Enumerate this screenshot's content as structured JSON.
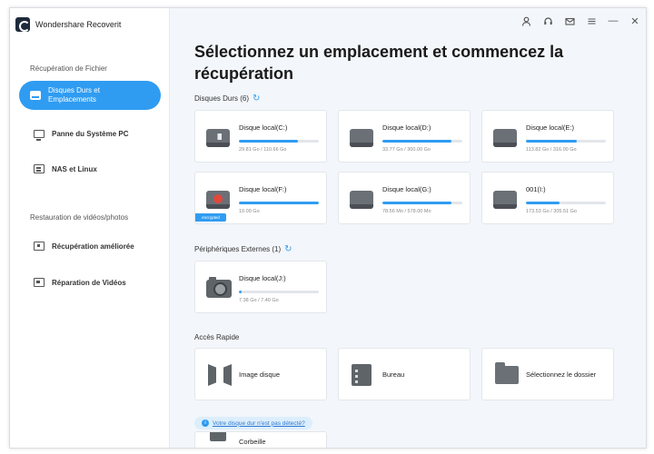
{
  "app": {
    "name": "Wondershare Recoverit"
  },
  "controls": {
    "icons": [
      "user-icon",
      "headset-icon",
      "mail-icon",
      "menu-icon",
      "minimize-icon",
      "close-icon"
    ],
    "minimize": "—",
    "close": "✕"
  },
  "sidebar": {
    "section1": "Récupération de Fichier",
    "section2": "Restauration de vidéos/photos",
    "items": [
      {
        "label1": "Disques Durs et",
        "label2": "Emplacements",
        "icon": "hard-drive-icon",
        "active": true
      },
      {
        "label": "Panne du Système PC",
        "icon": "pc-icon"
      },
      {
        "label": "NAS et Linux",
        "icon": "nas-icon"
      },
      {
        "label": "Récupération améliorée",
        "icon": "video-recovery-icon"
      },
      {
        "label": "Réparation de Vidéos",
        "icon": "video-repair-icon"
      }
    ]
  },
  "main": {
    "title": "Sélectionnez un emplacement et commencez la récupération",
    "disks_label": "Disques Durs (6)",
    "disks": [
      {
        "name": "Disque local(C:)",
        "size": "29.81 Go / 110.66 Go",
        "fill": 0.74,
        "icon": "windows-drive-icon"
      },
      {
        "name": "Disque local(D:)",
        "size": "33.77 Go / 300.00 Go",
        "fill": 0.86,
        "icon": "hard-drive-icon"
      },
      {
        "name": "Disque local(E:)",
        "size": "113.82 Go / 316.00 Go",
        "fill": 0.64,
        "icon": "hard-drive-icon"
      },
      {
        "name": "Disque local(F:)",
        "size": "10.00 Go",
        "fill": 1.0,
        "icon": "hard-drive-red-icon",
        "badge": "encrypted"
      },
      {
        "name": "Disque local(G:)",
        "size": "78.56 Mo / 578.00 Mo",
        "fill": 0.86,
        "icon": "hard-drive-icon"
      },
      {
        "name": "001(I:)",
        "size": "173.53 Go / 305.51 Go",
        "fill": 0.42,
        "icon": "hard-drive-icon"
      }
    ],
    "external_label": "Périphériques Externes (1)",
    "external": [
      {
        "name": "Disque local(J:)",
        "size": "7.38 Go / 7.40 Go",
        "fill": 0.03,
        "icon": "camera-icon"
      }
    ],
    "quick_label": "Accès Rapide",
    "quick": [
      {
        "label": "Image disque",
        "icon": "disk-image-icon"
      },
      {
        "label": "Bureau",
        "icon": "desktop-icon"
      },
      {
        "label": "Sélectionnez le dossier",
        "icon": "folder-icon"
      }
    ],
    "help_link": "Votre disque dur n'est pas détecté?",
    "trash_label": "Corbeille"
  },
  "colors": {
    "accent": "#2f9cf2",
    "sidebar_bg": "#ffffff",
    "main_bg": "#f3f6fa"
  }
}
